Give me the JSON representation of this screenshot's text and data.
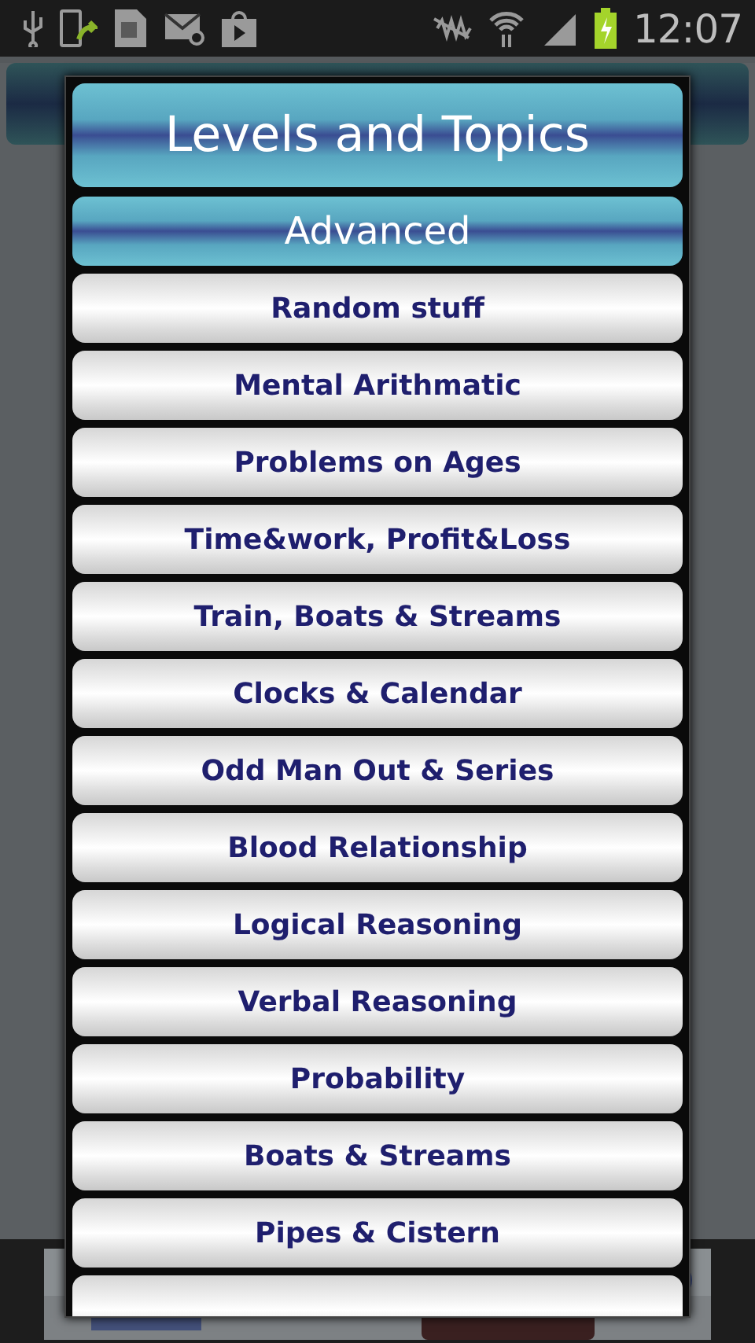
{
  "status_bar": {
    "time": "12:07",
    "battery_charging": true
  },
  "dialog": {
    "title": "Levels and Topics",
    "level": "Advanced",
    "topics": [
      "Random stuff",
      "Mental Arithmatic",
      "Problems on Ages",
      "Time&work, Profit&Loss",
      "Train, Boats & Streams",
      "Clocks & Calendar",
      "Odd Man Out & Series",
      "Blood Relationship",
      "Logical Reasoning",
      "Verbal Reasoning",
      "Probability",
      "Boats & Streams",
      "Pipes & Cistern"
    ]
  }
}
